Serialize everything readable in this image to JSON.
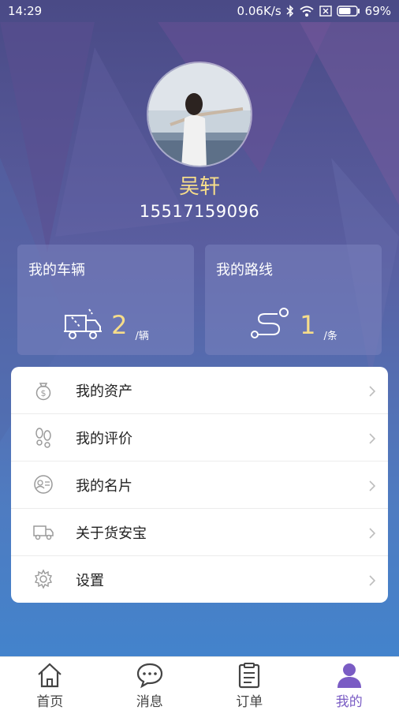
{
  "status_bar": {
    "time": "14:29",
    "network_speed": "0.06K/s",
    "battery_percent": "69%",
    "battery_level": 0.69
  },
  "profile": {
    "name": "吴轩",
    "phone": "15517159096"
  },
  "cards": {
    "vehicles": {
      "title": "我的车辆",
      "count": "2",
      "unit": "/辆",
      "icon": "truck-icon"
    },
    "routes": {
      "title": "我的路线",
      "count": "1",
      "unit": "/条",
      "icon": "route-icon"
    }
  },
  "menu": {
    "items": [
      {
        "label": "我的资产",
        "icon": "money-bag-icon"
      },
      {
        "label": "我的评价",
        "icon": "footprints-icon"
      },
      {
        "label": "我的名片",
        "icon": "id-card-icon"
      },
      {
        "label": "关于货安宝",
        "icon": "truck-icon"
      },
      {
        "label": "设置",
        "icon": "gear-icon"
      }
    ]
  },
  "tabs": [
    {
      "label": "首页",
      "icon": "home-icon"
    },
    {
      "label": "消息",
      "icon": "chat-icon"
    },
    {
      "label": "订单",
      "icon": "clipboard-icon"
    },
    {
      "label": "我的",
      "icon": "user-icon",
      "active": true
    }
  ],
  "colors": {
    "accent": "#7a5cc4",
    "highlight": "#f6dd8a",
    "icon_gray": "#9a9a9a"
  }
}
